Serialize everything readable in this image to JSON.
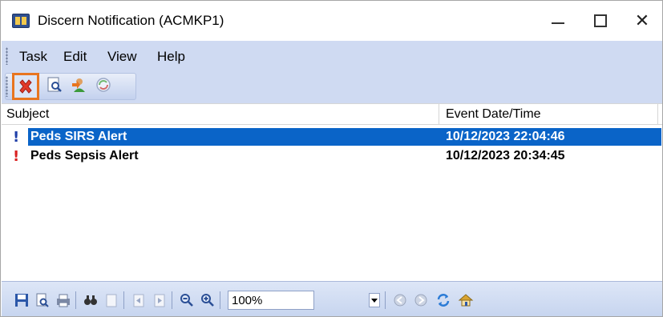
{
  "window": {
    "title": "Discern Notification (ACMKP1)",
    "close_glyph": "✕"
  },
  "menu": {
    "items": [
      "Task",
      "Edit",
      "View",
      "Help"
    ]
  },
  "toolbar": {
    "icons": [
      "delete-icon",
      "preview-icon",
      "forward-user-icon",
      "refresh-icon"
    ],
    "highlight_color": "#e8751f"
  },
  "list": {
    "columns": [
      "Subject",
      "Event Date/Time"
    ],
    "rows": [
      {
        "priority_mark": "!",
        "subject": "Peds SIRS Alert",
        "datetime": "10/12/2023 22:04:46",
        "selected": true
      },
      {
        "priority_mark": "!",
        "subject": "Peds Sepsis Alert",
        "datetime": "10/12/2023 20:34:45",
        "selected": false
      }
    ],
    "selection_color": "#0a64c8"
  },
  "bottom_toolbar": {
    "zoom": "100%",
    "icons": [
      "save-icon",
      "print-preview-icon",
      "print-icon",
      "find-icon",
      "page-icon",
      "page-prev-icon",
      "page-next-icon",
      "zoom-out-icon",
      "zoom-in-icon",
      "back-icon",
      "forward-icon",
      "refresh-icon",
      "home-icon"
    ]
  }
}
